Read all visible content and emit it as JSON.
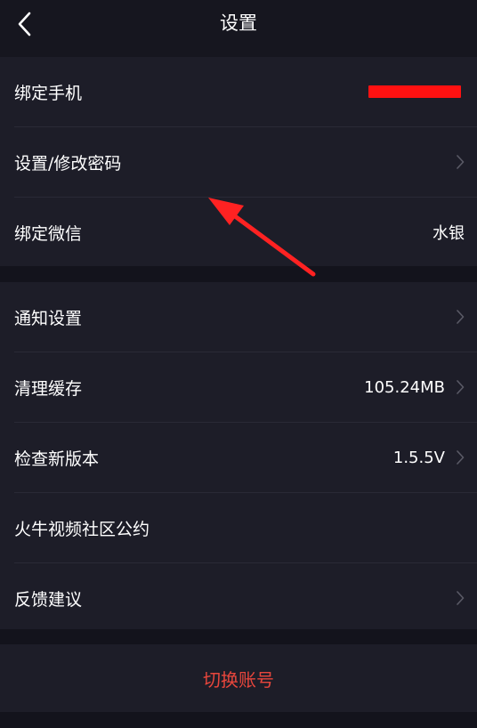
{
  "header": {
    "title": "设置"
  },
  "account_group": [
    {
      "label": "绑定手机",
      "value": "",
      "redacted": true,
      "chevron": false
    },
    {
      "label": "设置/修改密码",
      "value": "",
      "chevron": true
    },
    {
      "label": "绑定微信",
      "value": "水银",
      "chevron": false
    }
  ],
  "settings_group": [
    {
      "label": "通知设置",
      "value": "",
      "chevron": true
    },
    {
      "label": "清理缓存",
      "value": "105.24MB",
      "chevron": true
    },
    {
      "label": "检查新版本",
      "value": "1.5.5V",
      "chevron": true
    },
    {
      "label": "火牛视频社区公约",
      "value": "",
      "chevron": false
    },
    {
      "label": "反馈建议",
      "value": "",
      "chevron": true
    }
  ],
  "footer": {
    "switch_account": "切换账号"
  },
  "colors": {
    "background": "#13131c",
    "row_background": "#1d1d28",
    "accent_red": "#e8463c",
    "annotation_arrow": "#ff2222",
    "redaction": "#ff1111"
  }
}
